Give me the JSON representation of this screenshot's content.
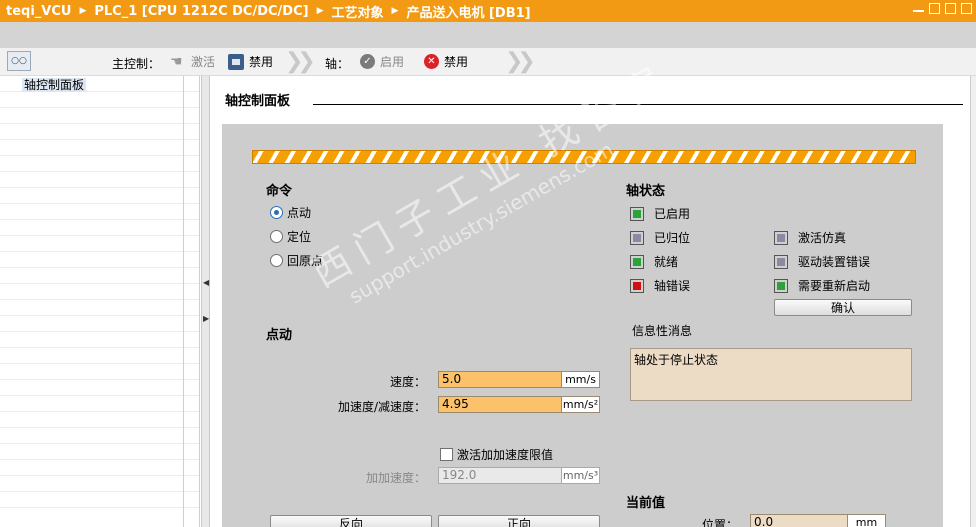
{
  "breadcrumb": [
    "teqi_VCU",
    "PLC_1 [CPU 1212C DC/DC/DC]",
    "工艺对象",
    "产品送入电机 [DB1]"
  ],
  "toolbar": {
    "master_label": "主控制：",
    "activate_label": "激活",
    "disable_master_label": "禁用",
    "axis_label": "轴：",
    "enable_label": "启用",
    "disable_axis_label": "禁用"
  },
  "tree": {
    "item": "轴控制面板"
  },
  "main": {
    "title": "轴控制面板"
  },
  "command": {
    "header": "命令",
    "options": [
      {
        "label": "点动",
        "selected": true
      },
      {
        "label": "定位",
        "selected": false
      },
      {
        "label": "回原点",
        "selected": false
      }
    ]
  },
  "axis_status": {
    "header": "轴状态",
    "items": [
      {
        "label": "已启用",
        "state": "green"
      },
      {
        "label": "已归位",
        "state": "gray"
      },
      {
        "label": "就绪",
        "state": "green"
      },
      {
        "label": "轴错误",
        "state": "red"
      },
      {
        "label": "激活仿真",
        "state": "gray"
      },
      {
        "label": "驱动装置错误",
        "state": "gray"
      },
      {
        "label": "需要重新启动",
        "state": "green"
      }
    ],
    "confirm_label": "确认"
  },
  "info": {
    "label": "信息性消息",
    "message": "轴处于停止状态"
  },
  "jog": {
    "header": "点动",
    "speed_label": "速度：",
    "speed_value": "5.0",
    "speed_unit": "mm/s",
    "accel_label": "加速度/减速度：",
    "accel_value": "4.95",
    "accel_unit": "mm/s²",
    "jerk_check_label": "激活加加速度限值",
    "jerk_label": "加加速度：",
    "jerk_value": "192.0",
    "jerk_unit": "mm/s³",
    "reverse_label": "反向",
    "forward_label": "正向"
  },
  "current": {
    "header": "当前值",
    "position_label": "位置：",
    "position_value": "0.0",
    "position_unit": "mm"
  },
  "watermark": {
    "cn": "西门子工业 找答案",
    "en": "support.industry.siemens.com"
  }
}
